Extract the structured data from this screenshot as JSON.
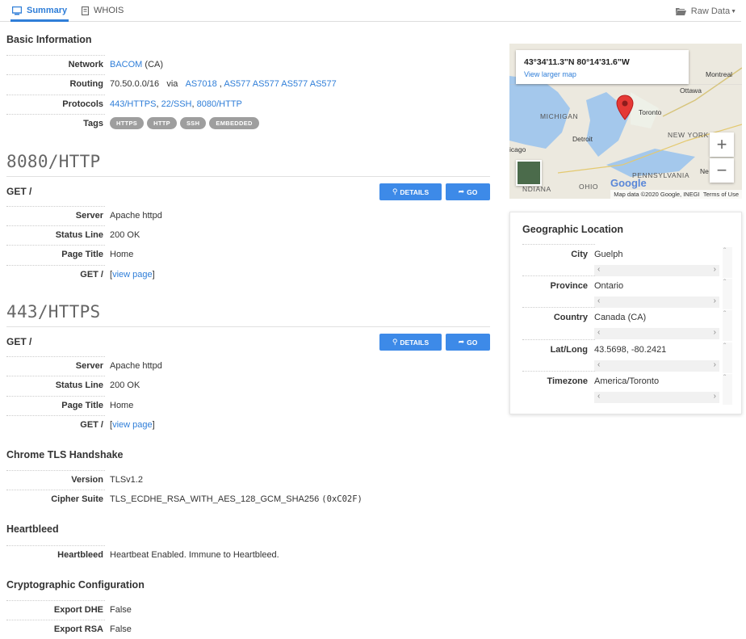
{
  "tabs": {
    "summary": "Summary",
    "whois": "WHOIS",
    "raw": "Raw Data"
  },
  "basic": {
    "title": "Basic Information",
    "network_label": "Network",
    "network_link": "BACOM",
    "network_suffix": "(CA)",
    "routing_label": "Routing",
    "routing_prefix": "70.50.0.0/16",
    "routing_via": "via",
    "routing_as1": "AS7018",
    "routing_sep": ",",
    "routing_as2": "AS577 AS577 AS577 AS577",
    "protocols_label": "Protocols",
    "proto1": "443/HTTPS",
    "proto2": "22/SSH",
    "proto3": "8080/HTTP",
    "tags_label": "Tags",
    "tags": [
      "HTTPS",
      "HTTP",
      "SSH",
      "EMBEDDED"
    ]
  },
  "http8080": {
    "heading": "8080/HTTP",
    "get": "GET /",
    "details": "DETAILS",
    "go": "GO",
    "server_label": "Server",
    "server": "Apache httpd",
    "status_label": "Status Line",
    "status": "200 OK",
    "title_label": "Page Title",
    "title": "Home",
    "get_label": "GET /",
    "view_open": "[",
    "view": "view page",
    "view_close": "]"
  },
  "https443": {
    "heading": "443/HTTPS",
    "get": "GET /",
    "details": "DETAILS",
    "go": "GO",
    "server_label": "Server",
    "server": "Apache httpd",
    "status_label": "Status Line",
    "status": "200 OK",
    "title_label": "Page Title",
    "title": "Home",
    "get_label": "GET /",
    "view_open": "[",
    "view": "view page",
    "view_close": "]"
  },
  "tls": {
    "title": "Chrome TLS Handshake",
    "version_label": "Version",
    "version": "TLSv1.2",
    "cipher_label": "Cipher Suite",
    "cipher": "TLS_ECDHE_RSA_WITH_AES_128_GCM_SHA256",
    "cipher_hex": "(0xC02F)"
  },
  "heartbleed": {
    "title": "Heartbleed",
    "label": "Heartbleed",
    "value": "Heartbeat Enabled. Immune to Heartbleed."
  },
  "crypto": {
    "title": "Cryptographic Configuration",
    "dhe_label": "Export DHE",
    "dhe": "False",
    "rsa_label": "Export RSA",
    "rsa": "False"
  },
  "map": {
    "coord": "43°34'11.3\"N 80°14'31.6\"W",
    "larger": "View larger map",
    "labels": {
      "montreal": "Montreal",
      "ottawa": "Ottawa",
      "michigan": "MICHIGAN",
      "toronto": "Toronto",
      "detroit": "Detroit",
      "newyork": "NEW YORK",
      "chicago": "icago",
      "ohio": "OHIO",
      "pennsylvania": "PENNSYLVANIA",
      "indiana": "NDIANA",
      "ne": "Ne"
    },
    "google": "Google",
    "data": "Map data ©2020 Google, INEGI",
    "terms": "Terms of Use",
    "zoom_in": "+",
    "zoom_out": "−"
  },
  "geo": {
    "title": "Geographic Location",
    "city_label": "City",
    "city": "Guelph",
    "province_label": "Province",
    "province": "Ontario",
    "country_label": "Country",
    "country": "Canada (CA)",
    "latlong_label": "Lat/Long",
    "latlong": "43.5698, -80.2421",
    "timezone_label": "Timezone",
    "timezone": "America/Toronto"
  },
  "colors": {
    "accent": "#2f7ed8",
    "button": "#3d8ae8",
    "tag": "#9e9e9e",
    "pin": "#e53935"
  }
}
